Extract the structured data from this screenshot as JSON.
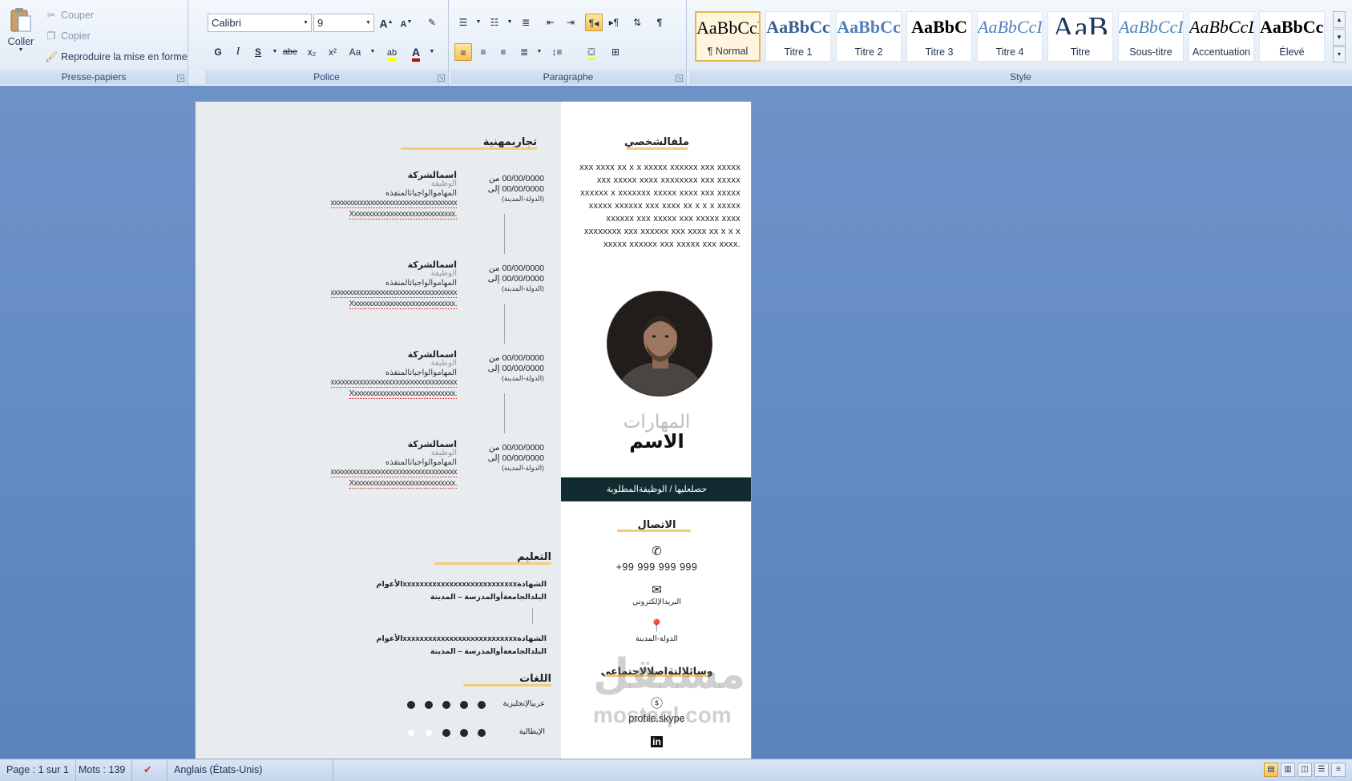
{
  "clipboard": {
    "paste": "Coller",
    "cut": "Couper",
    "copy": "Copier",
    "format_painter": "Reproduire la mise en forme",
    "group": "Presse-papiers"
  },
  "font": {
    "name": "Calibri",
    "size": "9",
    "group": "Police",
    "bold": "G",
    "italic": "I",
    "underline": "S",
    "strike": "abe",
    "sub": "x₂",
    "sup": "x²",
    "case": "Aa"
  },
  "paragraph": {
    "group": "Paragraphe"
  },
  "styles": {
    "group": "Style",
    "items": [
      {
        "preview": "AaBbCcD",
        "name": "¶ Normal",
        "color": "#000000"
      },
      {
        "preview": "AaBbCc",
        "name": "Titre 1",
        "color": "#365f91"
      },
      {
        "preview": "AaBbCc",
        "name": "Titre 2",
        "color": "#4f81bd"
      },
      {
        "preview": "AaBbC",
        "name": "Titre 3",
        "color": "#000000"
      },
      {
        "preview": "AaBbCcI",
        "name": "Titre 4",
        "color": "#4f81bd"
      },
      {
        "preview": "AaB",
        "name": "Titre",
        "color": "#17365d"
      },
      {
        "preview": "AaBbCcI",
        "name": "Sous-titre",
        "color": "#4f81bd"
      },
      {
        "preview": "AaBbCcD",
        "name": "Accentuation",
        "color": "#000000"
      },
      {
        "preview": "AaBbCcI",
        "name": "Élevé",
        "color": "#000000"
      }
    ]
  },
  "doc": {
    "experience_title": "تجاربمهنية",
    "jobs": [
      {
        "company": "اسمالشركة",
        "title": "الوظيفة",
        "tasks": "المهاموالواجباتالمنفذه",
        "x1": "xxxxxxxxxxxxxxxxxxxxxxxxxxxxxxxxxxx",
        "x2": "Xxxxxxxxxxxxxxxxxxxxxxxxxxxxx.",
        "from": "00/00/0000 من",
        "to": "00/00/0000 إلى",
        "place": "(الدولة-المدينة)"
      },
      {
        "company": "اسمالشركة",
        "title": "الوظيفة",
        "tasks": "المهاموالواجباتالمنفذه",
        "x1": "xxxxxxxxxxxxxxxxxxxxxxxxxxxxxxxxxxx",
        "x2": "Xxxxxxxxxxxxxxxxxxxxxxxxxxxxx.",
        "from": "00/00/0000 من",
        "to": "00/00/0000 إلى",
        "place": "(الدولة-المدينة)"
      },
      {
        "company": "اسمالشركة",
        "title": "الوظيفة",
        "tasks": "المهاموالواجباتالمنفذه",
        "x1": "xxxxxxxxxxxxxxxxxxxxxxxxxxxxxxxxxxx",
        "x2": "Xxxxxxxxxxxxxxxxxxxxxxxxxxxxx.",
        "from": "00/00/0000 من",
        "to": "00/00/0000 إلى",
        "place": "(الدولة-المدينة)"
      },
      {
        "company": "اسمالشركة",
        "title": "الوظيفة",
        "tasks": "المهاموالواجباتالمنفذه",
        "x1": "xxxxxxxxxxxxxxxxxxxxxxxxxxxxxxxxxxx",
        "x2": "Xxxxxxxxxxxxxxxxxxxxxxxxxxxxx.",
        "from": "00/00/0000 من",
        "to": "00/00/0000 إلى",
        "place": "(الدولة-المدينة)"
      }
    ],
    "education_title": "التعليم",
    "edu": [
      {
        "l1": "الشهادةxxxxxxxxxxxxxxxxxxxxxxxxxxxالأعوام",
        "l2": "البلدالجامعةأوالمدرسة – المدينة"
      },
      {
        "l1": "الشهادةxxxxxxxxxxxxxxxxxxxxxxxxxxxالأعوام",
        "l2": "البلدالجامعةأوالمدرسة – المدينة"
      }
    ],
    "languages_title": "اللغات",
    "languages": [
      {
        "name": "عربيالإنجليزية",
        "level": 5
      },
      {
        "name": "الإيطالية",
        "level": 3
      }
    ],
    "profile_title": "ملفالشخصي",
    "profile_text": "xxx xxxx  xx x x xxxxx xxxxxx xxx xxxxx xxx xxxxx xxxx xxxxxxxx xxx xxxxx xxxxxx x xxxxxxx xxxxx xxxx xxx  xxxxx xxxxx xxxxxx xxx xxxx  xx x x x xxxxx xxxxxx xxx xxxxx xxx xxxxx xxxx xxxxxxxx xxx xxxxxx xxx xxxx  xx x x x xxxxx xxxxxx xxx xxxxx xxx xxxx.",
    "skills_title": "المهارات",
    "name": "الاسم",
    "job_bar": "حصلعليها / الوظيفةالمطلوبة",
    "contact_title": "الاتصال",
    "phone": "+99 999 999 999",
    "email": "البريدالإلكتروني",
    "location": "الدولة-المدينة",
    "social_title": "وسائلالتواصلالاجتماعي",
    "skype": "profile.skype",
    "watermark1": "مستقل",
    "watermark2": "mostaql.com"
  },
  "status": {
    "page": "Page : 1 sur 1",
    "words": "Mots : 139",
    "lang": "Anglais (États-Unis)"
  }
}
